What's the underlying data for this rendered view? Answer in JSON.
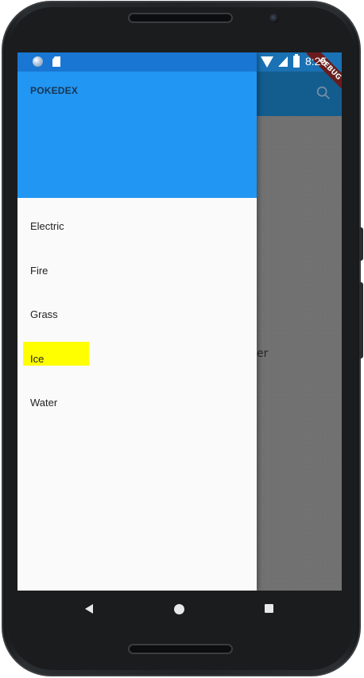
{
  "status_bar": {
    "time": "8:25"
  },
  "background_app": {
    "partial_text": "er",
    "debug_banner": "DEBUG"
  },
  "drawer": {
    "title": "POKEDEX",
    "header_color": "#2196f3",
    "items": [
      {
        "label": "Electric",
        "highlighted": false
      },
      {
        "label": "Fire",
        "highlighted": false
      },
      {
        "label": "Grass",
        "highlighted": false
      },
      {
        "label": "Ice",
        "highlighted": true,
        "highlight_color": "#ffff00"
      },
      {
        "label": "Water",
        "highlighted": false
      }
    ]
  },
  "navigation_bar": {
    "icons": [
      "back-icon",
      "home-icon",
      "recent-apps-icon"
    ]
  }
}
